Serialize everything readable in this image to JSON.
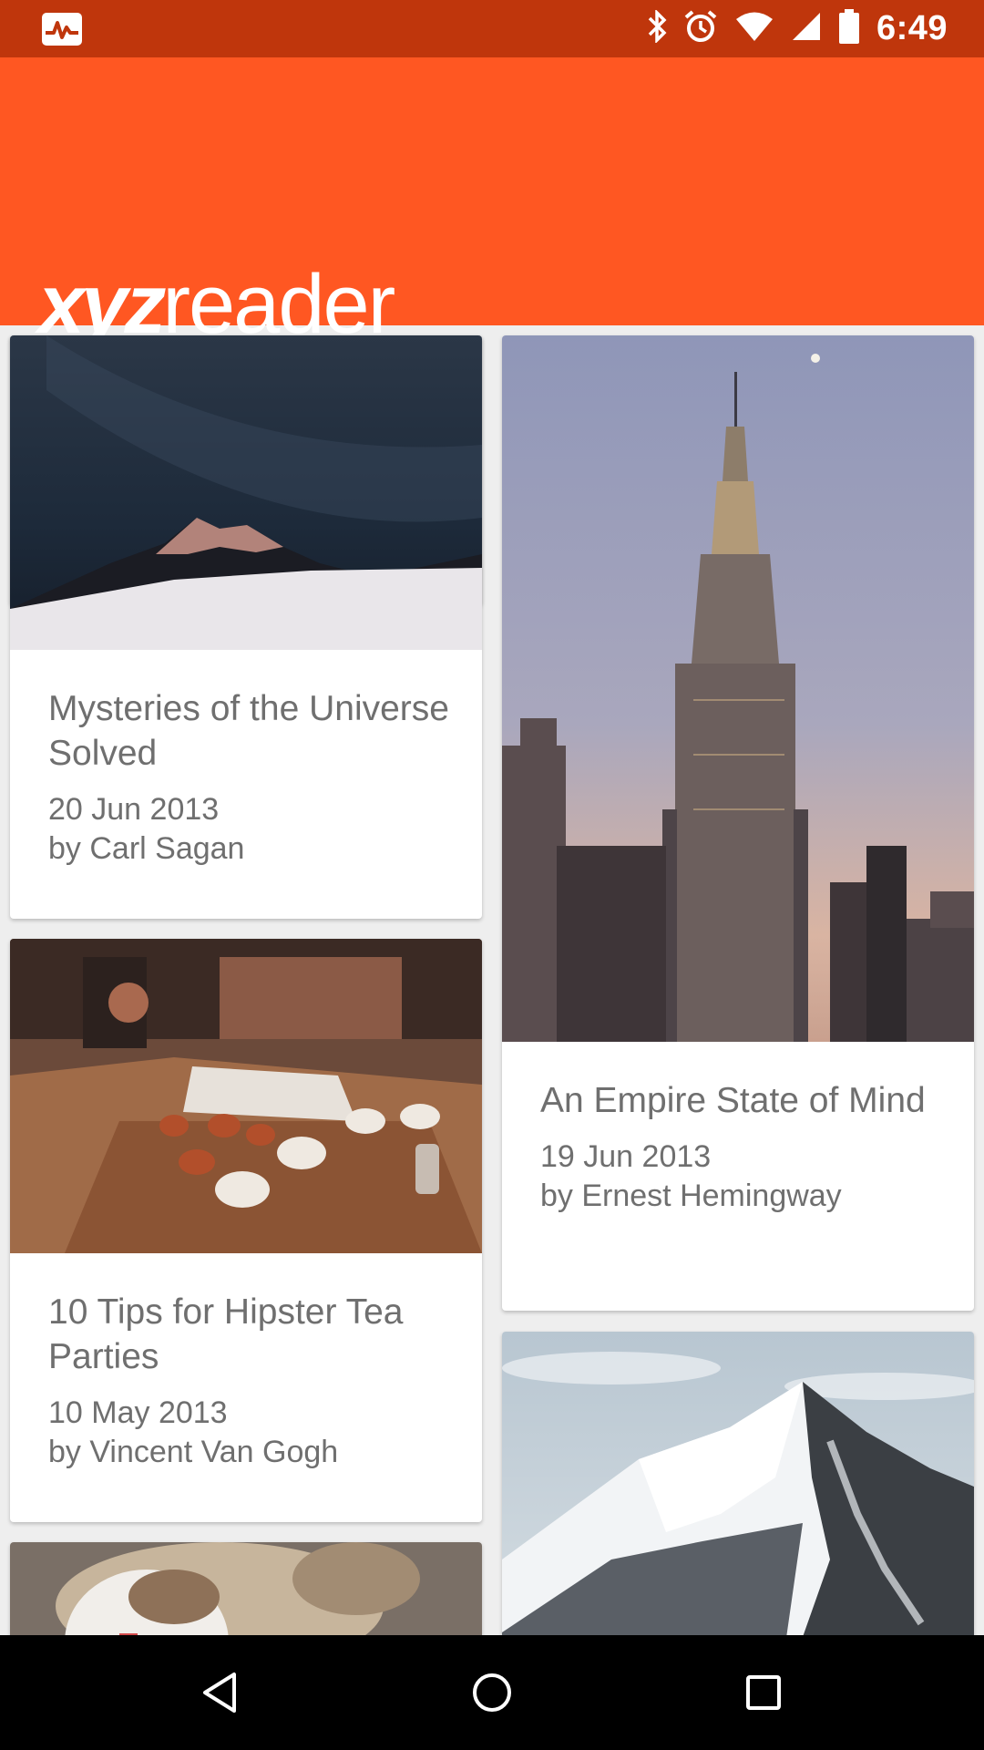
{
  "status_bar": {
    "time": "6:49",
    "icons": [
      "pulse-icon",
      "bluetooth-icon",
      "alarm-icon",
      "wifi-icon",
      "signal-icon",
      "battery-icon"
    ]
  },
  "app": {
    "logo_bold": "xyz",
    "logo_light": "reader",
    "brand_color": "#ff5722",
    "status_color": "#bf360c"
  },
  "articles": [
    {
      "title": "Mysteries of the Universe Solved",
      "date": "20 Jun 2013",
      "author": "by Carl Sagan",
      "image": "night-sky-mountain-image"
    },
    {
      "title": "An Empire State of Mind",
      "date": "19 Jun 2013",
      "author": "by Ernest Hemingway",
      "image": "empire-state-building-image"
    },
    {
      "title": "10 Tips for Hipster Tea Parties",
      "date": "10 May 2013",
      "author": "by Vincent Van Gogh",
      "image": "tea-cups-table-image"
    },
    {
      "title": "",
      "date": "",
      "author": "",
      "image": "snowy-mountain-image"
    },
    {
      "title": "",
      "date": "",
      "author": "",
      "image": "dog-image"
    }
  ],
  "nav": {
    "back": "back-icon",
    "home": "home-icon",
    "recents": "recents-icon"
  }
}
